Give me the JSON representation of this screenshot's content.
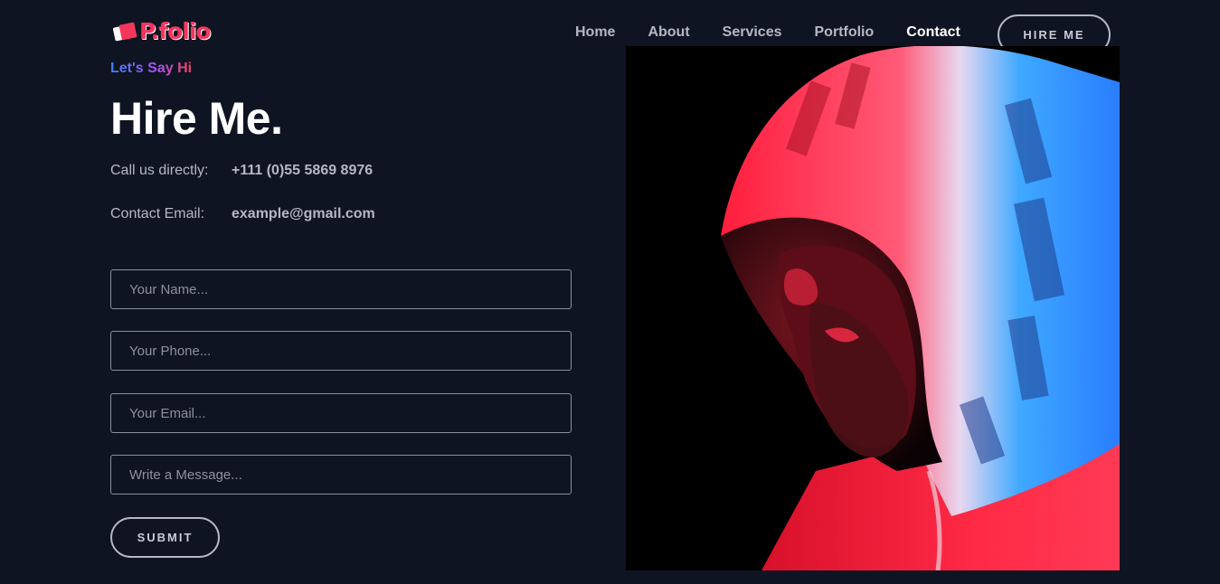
{
  "header": {
    "logo_text": "P.folio",
    "nav": [
      {
        "label": "Home"
      },
      {
        "label": "About"
      },
      {
        "label": "Services"
      },
      {
        "label": "Portfolio"
      },
      {
        "label": "Contact",
        "active": true
      }
    ],
    "hire_label": "HIRE ME"
  },
  "contact": {
    "subtitle": "Let's Say Hi",
    "title": "Hire Me.",
    "phone_label": "Call us directly:",
    "phone_value": "+111 (0)55 5869 8976",
    "email_label": "Contact Email:",
    "email_value": "example@gmail.com"
  },
  "form": {
    "name_placeholder": "Your Name...",
    "phone_placeholder": "Your Phone...",
    "email_placeholder": "Your Email...",
    "message_placeholder": "Write a Message...",
    "submit_label": "SUBMIT"
  },
  "colors": {
    "background": "#0e1422",
    "accent": "#f5365c",
    "muted_text": "#b4b8c3"
  }
}
